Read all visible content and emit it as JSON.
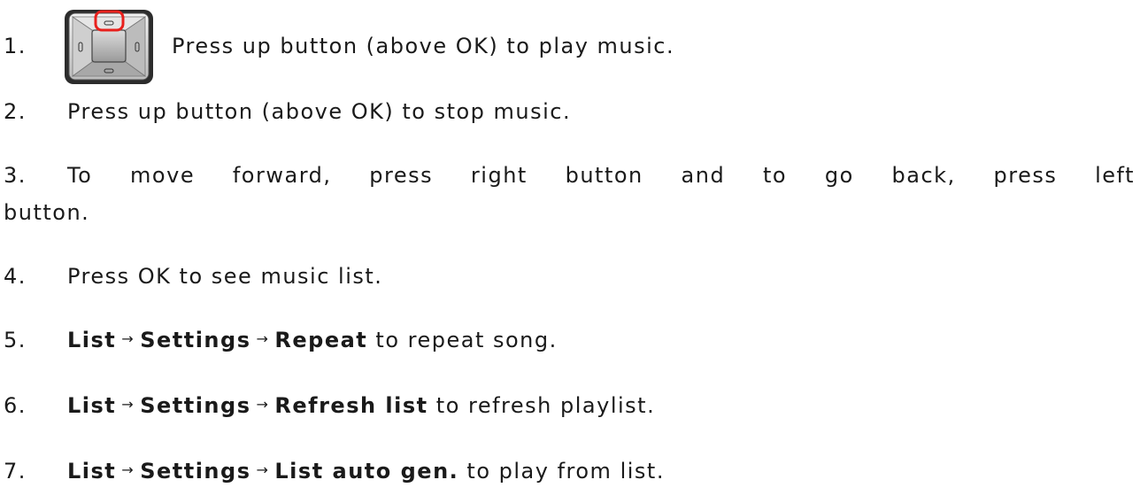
{
  "steps": [
    {
      "number": "1.",
      "text": "Press up button (above OK) to play music."
    },
    {
      "number": "2.",
      "text": "Press up button (above OK) to stop music."
    },
    {
      "number": "3.",
      "text_line1": "To move forward, press right button and to go back, press left",
      "text_line2": "button."
    },
    {
      "number": "4.",
      "text": "Press OK to see music list."
    },
    {
      "number": "5.",
      "path": [
        "List",
        "Settings",
        "Repeat"
      ],
      "suffix": "to repeat song."
    },
    {
      "number": "6.",
      "path": [
        "List",
        "Settings",
        "Refresh list"
      ],
      "suffix": "to refresh playlist."
    },
    {
      "number": "7.",
      "path": [
        "List",
        "Settings",
        "List auto gen."
      ],
      "suffix": "to play from list."
    }
  ],
  "arrow_glyph": "→",
  "icons": {
    "keypad": "navigation-keypad-icon",
    "highlight_color": "#e8201c"
  }
}
